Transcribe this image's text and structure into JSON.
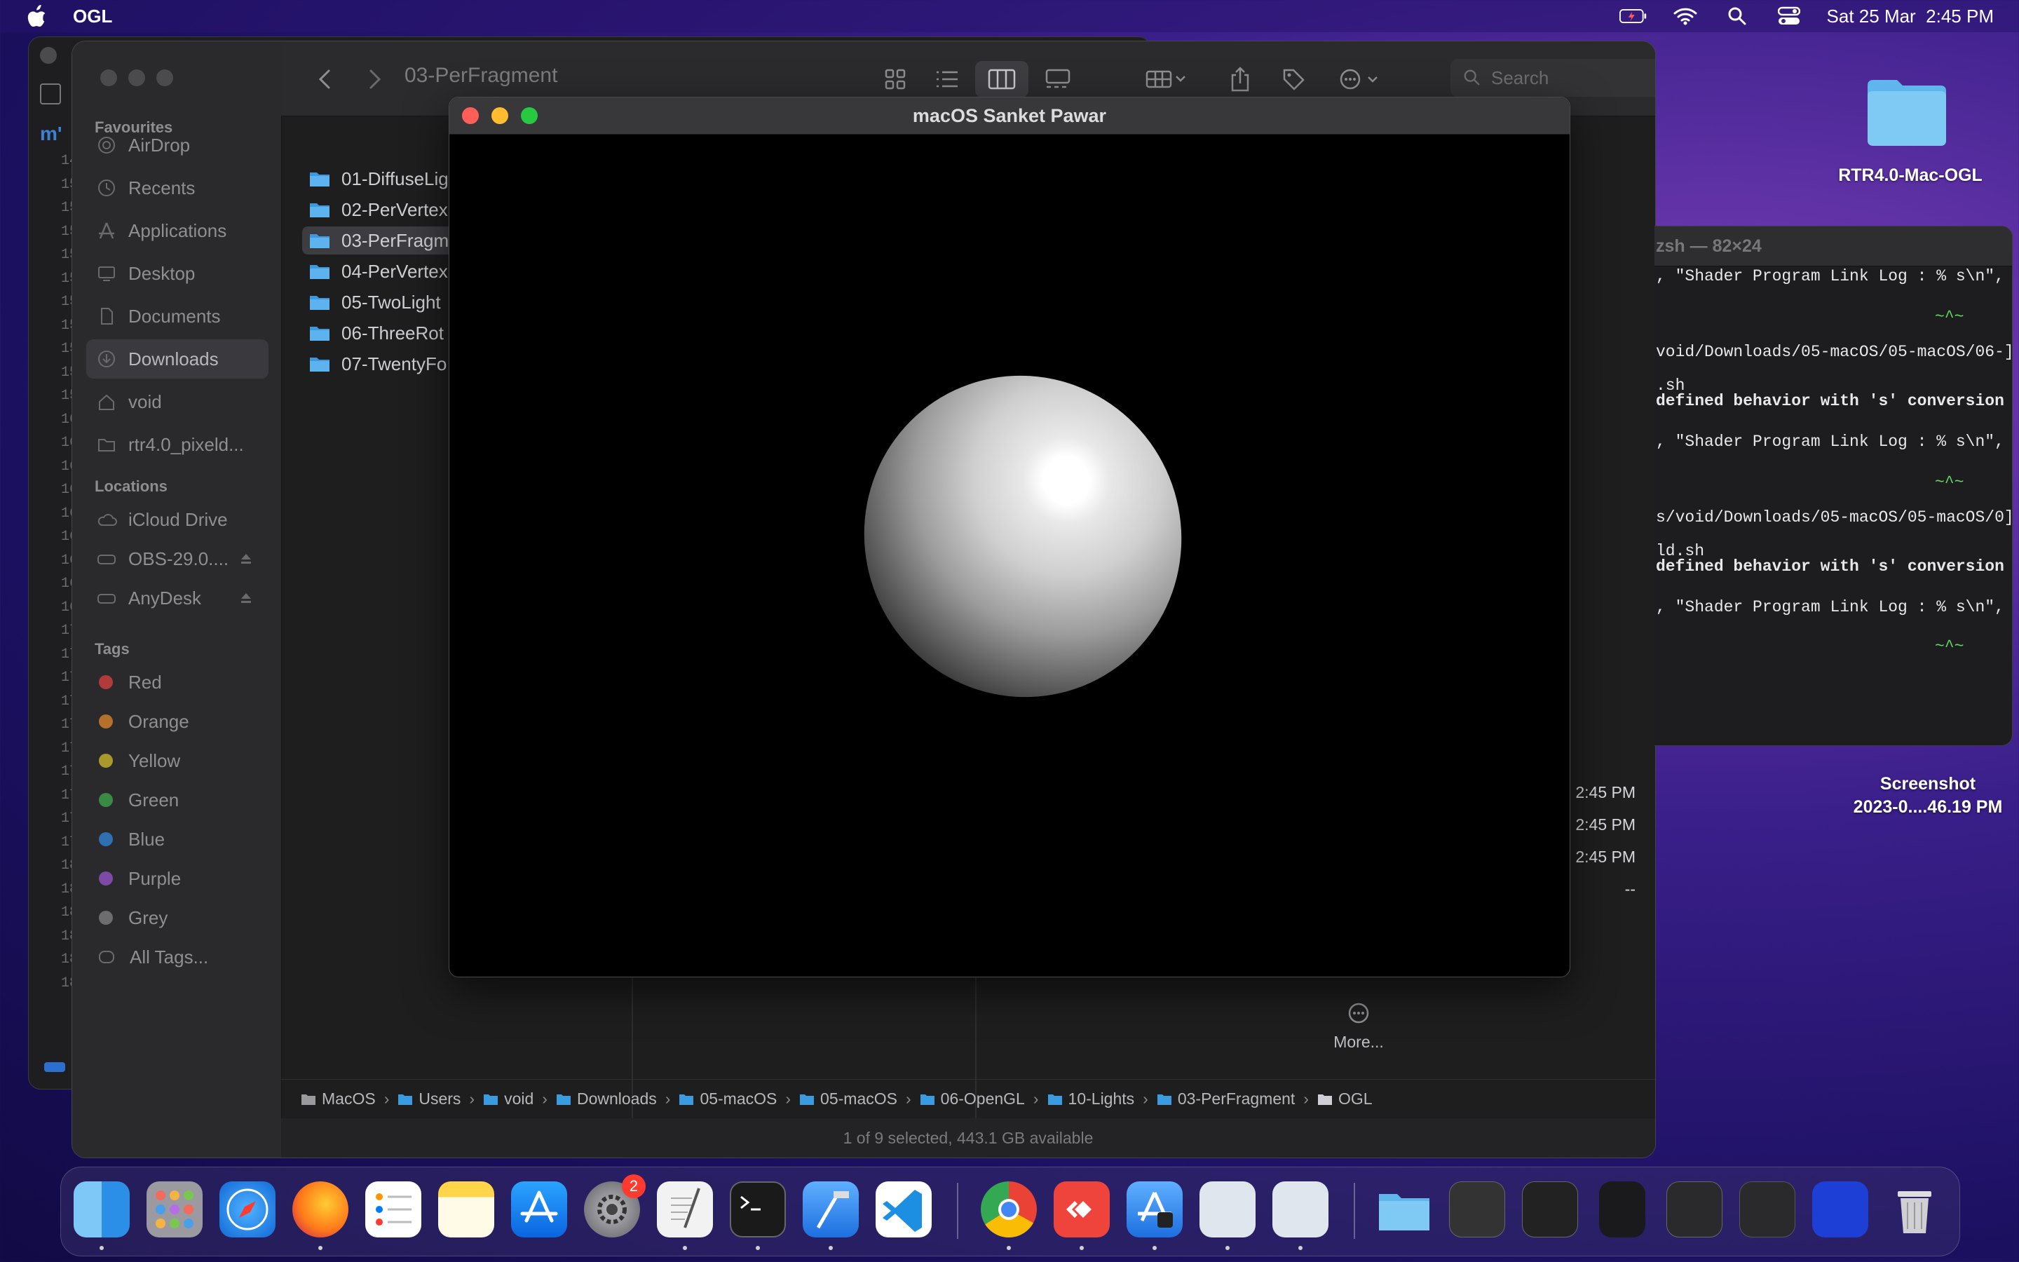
{
  "menubar": {
    "app_name": "OGL",
    "date_time": "Sat 25 Mar  2:45 PM"
  },
  "desktop": {
    "folder_label": "RTR4.0-Mac-OGL",
    "screenshot_label_1": "Screenshot",
    "screenshot_label_2": "2023-0....46.19 PM"
  },
  "xcode": {
    "line_numbers": [
      "14",
      "15",
      "15",
      "15",
      "15",
      "15",
      "15",
      "15",
      "15",
      "15",
      "15",
      "16",
      "16",
      "16",
      "16",
      "16",
      "16",
      "16",
      "16",
      "16",
      "17",
      "17",
      "17",
      "17",
      "17",
      "17",
      "17",
      "17",
      "17",
      "17",
      "18",
      "18",
      "18",
      "18",
      "18",
      "18"
    ]
  },
  "finder": {
    "title": "03-PerFragment",
    "search_placeholder": "Search",
    "sidebar": {
      "favourites_heading": "Favourites",
      "favourites": [
        "AirDrop",
        "Recents",
        "Applications",
        "Desktop",
        "Documents",
        "Downloads",
        "void",
        "rtr4.0_pixeld..."
      ],
      "locations_heading": "Locations",
      "locations": [
        "iCloud Drive",
        "OBS-29.0....",
        "AnyDesk"
      ],
      "tags_heading": "Tags",
      "tags": [
        {
          "label": "Red",
          "color": "#b23a3a"
        },
        {
          "label": "Orange",
          "color": "#b5702a"
        },
        {
          "label": "Yellow",
          "color": "#a89a2a"
        },
        {
          "label": "Green",
          "color": "#3a8a45"
        },
        {
          "label": "Blue",
          "color": "#2f6fb3"
        },
        {
          "label": "Purple",
          "color": "#7d4aa6"
        },
        {
          "label": "Grey",
          "color": "#6d6d70"
        },
        {
          "label": "All Tags...",
          "color": ""
        }
      ]
    },
    "files": [
      "01-DiffuseLig",
      "02-PerVertex",
      "03-PerFragm",
      "04-PerVertex",
      "05-TwoLight",
      "06-ThreeRot",
      "07-TwentyFo"
    ],
    "dates": [
      "2:45 PM",
      "2:45 PM",
      "2:45 PM",
      "--"
    ],
    "more_label": "More...",
    "path": [
      "MacOS",
      "Users",
      "void",
      "Downloads",
      "05-macOS",
      "05-macOS",
      "06-OpenGL",
      "10-Lights",
      "03-PerFragment",
      "OGL"
    ],
    "status": "1 of 9 selected, 443.1 GB available"
  },
  "gl_window": {
    "title": "macOS Sanket Pawar"
  },
  "terminal": {
    "title": "zsh — 82×24",
    "lines": [
      ", \"Shader Program Link Log : % s\\n\",",
      "~^~",
      "void/Downloads/05-macOS/05-macOS/06-]",
      ".sh",
      "defined behavior with 's' conversion",
      ", \"Shader Program Link Log : % s\\n\",",
      "~^~",
      "s/void/Downloads/05-macOS/05-macOS/0]",
      "ld.sh",
      "defined behavior with 's' conversion",
      ", \"Shader Program Link Log : % s\\n\",",
      "~^~"
    ]
  },
  "dock": {
    "badge_count": "2"
  }
}
